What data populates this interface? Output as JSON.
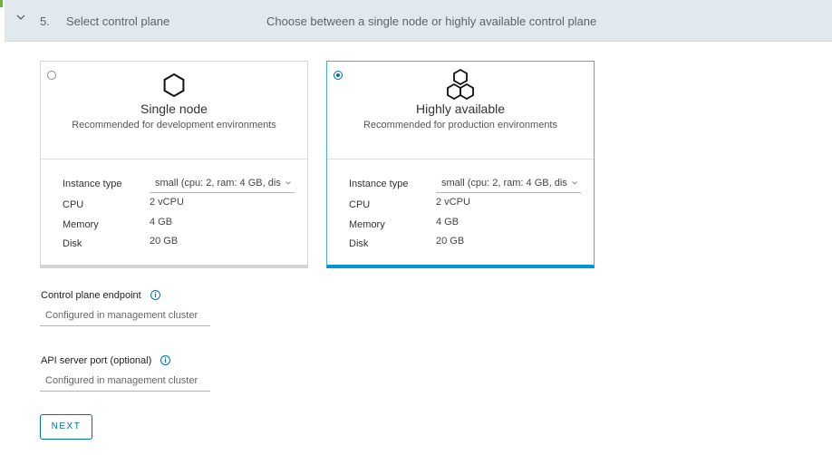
{
  "header": {
    "step_number": "5.",
    "title": "Select control plane",
    "description": "Choose between a single node or highly available control plane"
  },
  "options": [
    {
      "name": "Single node",
      "description": "Recommended for development environments",
      "selected": false,
      "icon": "hexagon-icon",
      "instance_type_label": "Instance type",
      "instance_type_value": "small (cpu: 2, ram: 4 GB, dis",
      "cpu_label": "CPU",
      "cpu_value": "2 vCPU",
      "memory_label": "Memory",
      "memory_value": "4 GB",
      "disk_label": "Disk",
      "disk_value": "20 GB"
    },
    {
      "name": "Highly available",
      "description": "Recommended for production environments",
      "selected": true,
      "icon": "hexagon-cluster-icon",
      "instance_type_label": "Instance type",
      "instance_type_value": "small (cpu: 2, ram: 4 GB, dis",
      "cpu_label": "CPU",
      "cpu_value": "2 vCPU",
      "memory_label": "Memory",
      "memory_value": "4 GB",
      "disk_label": "Disk",
      "disk_value": "20 GB"
    }
  ],
  "fields": {
    "endpoint_label": "Control plane endpoint",
    "endpoint_placeholder": "Configured in management cluster",
    "port_label": "API server port (optional)",
    "port_placeholder": "Configured in management cluster"
  },
  "next_label": "NEXT",
  "colors": {
    "accent": "#0072a3",
    "header_bg": "#e2e9ee",
    "selected_border": "#0095d3"
  }
}
